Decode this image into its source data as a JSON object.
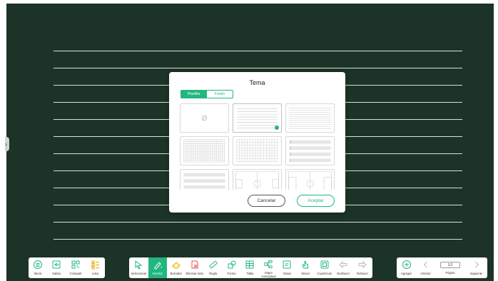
{
  "dialog": {
    "title": "Tema",
    "tabs": [
      "Plantilla",
      "Fondo"
    ],
    "active_tab": "Plantilla",
    "buttons": {
      "cancel": "Cancelar",
      "accept": "Aceptar"
    }
  },
  "left_toolbar": {
    "items": [
      {
        "label": "Menú",
        "icon": "menu-icon"
      },
      {
        "label": "Salida",
        "icon": "exit-icon"
      },
      {
        "label": "Comparti",
        "icon": "qr-share-icon"
      },
      {
        "label": "Lista",
        "icon": "list-icon"
      }
    ]
  },
  "center_toolbar": {
    "items": [
      {
        "label": "Seleccionar",
        "icon": "select-cursor-icon"
      },
      {
        "label": "Escribir",
        "icon": "pen-icon",
        "active": true
      },
      {
        "label": "Borrador",
        "icon": "eraser-icon"
      },
      {
        "label": "Eliminar todo",
        "icon": "clear-all-icon"
      },
      {
        "label": "Regla",
        "icon": "ruler-icon"
      },
      {
        "label": "Forma",
        "icon": "shape-icon"
      },
      {
        "label": "Tabla",
        "icon": "table-icon"
      },
      {
        "label": "Mapa conceptual",
        "icon": "mind-map-icon"
      },
      {
        "label": "Notas",
        "icon": "notes-icon"
      },
      {
        "label": "Mover",
        "icon": "hand-move-icon"
      },
      {
        "label": "Cuadrícula",
        "icon": "grid-icon"
      },
      {
        "label": "Deshacer",
        "icon": "undo-icon"
      },
      {
        "label": "Rehacer",
        "icon": "redo-icon"
      }
    ]
  },
  "right_toolbar": {
    "add_label": "Agregar",
    "prev_label": "Anterior",
    "page_indicator": "1/1",
    "page_label": "Página",
    "next_label": "Siguiente"
  },
  "colors": {
    "board": "#1c3327",
    "accent": "#21b77f",
    "ruled_line": "#d9e0db"
  }
}
